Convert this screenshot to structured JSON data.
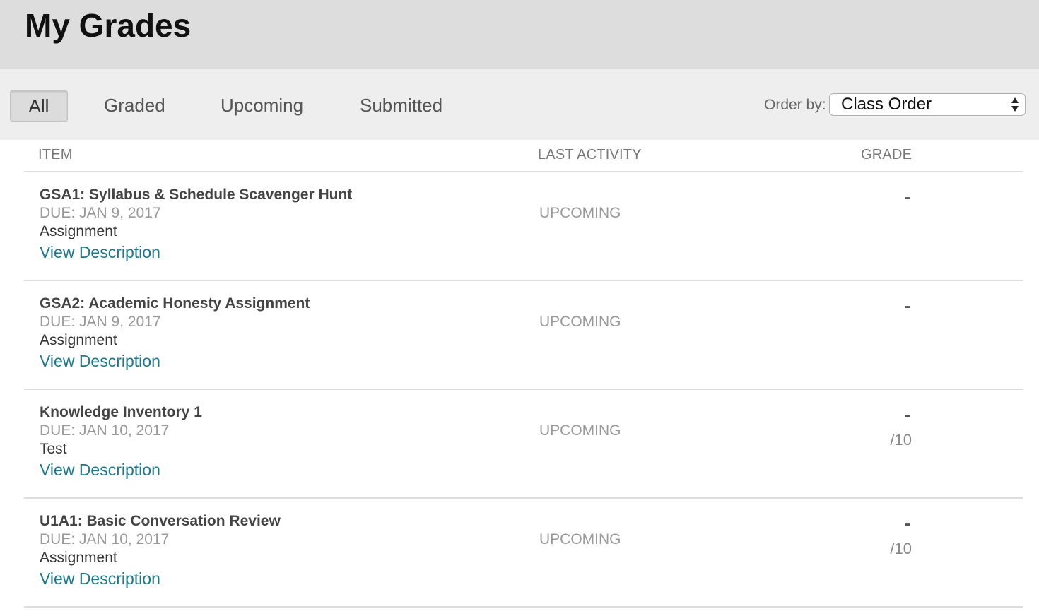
{
  "header": {
    "title": "My Grades"
  },
  "filters": {
    "tabs": [
      {
        "label": "All",
        "active": true
      },
      {
        "label": "Graded",
        "active": false
      },
      {
        "label": "Upcoming",
        "active": false
      },
      {
        "label": "Submitted",
        "active": false
      }
    ],
    "order_label": "Order by:",
    "order_value": "Class Order"
  },
  "table": {
    "columns": [
      "ITEM",
      "LAST ACTIVITY",
      "GRADE"
    ],
    "rows": [
      {
        "title": "GSA1: Syllabus & Schedule Scavenger Hunt",
        "due": "DUE: JAN 9, 2017",
        "type": "Assignment",
        "link": "View Description",
        "activity": "UPCOMING",
        "grade": "-",
        "points": ""
      },
      {
        "title": "GSA2: Academic Honesty Assignment",
        "due": "DUE: JAN 9, 2017",
        "type": "Assignment",
        "link": "View Description",
        "activity": "UPCOMING",
        "grade": "-",
        "points": ""
      },
      {
        "title": "Knowledge Inventory 1",
        "due": "DUE: JAN 10, 2017",
        "type": "Test",
        "link": "View Description",
        "activity": "UPCOMING",
        "grade": "-",
        "points": "/10"
      },
      {
        "title": "U1A1: Basic Conversation Review",
        "due": "DUE: JAN 10, 2017",
        "type": "Assignment",
        "link": "View Description",
        "activity": "UPCOMING",
        "grade": "-",
        "points": "/10"
      }
    ]
  },
  "colors": {
    "link": "#1a7a8c",
    "title_bar": "#dddddd",
    "filter_bar": "#eeeeee"
  }
}
